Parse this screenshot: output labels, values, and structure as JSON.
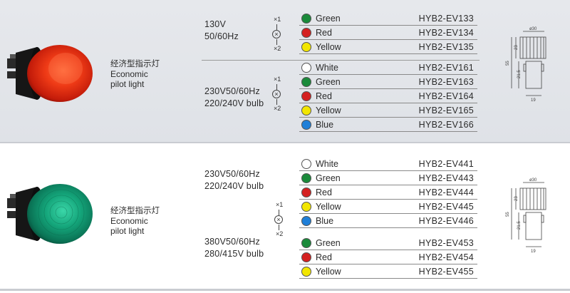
{
  "colors": {
    "green": "#1a8a3a",
    "red": "#d42020",
    "yellow": "#f2e600",
    "white": "#ffffff",
    "blue": "#1f7fd8"
  },
  "products": [
    {
      "name_cn": "经济型指示灯",
      "name_en_1": "Economic",
      "name_en_2": "pilot light",
      "symbol": {
        "x1": "×1",
        "x2": "×2"
      },
      "drawing": {
        "dim_top": "ø30",
        "dim_h1": "23",
        "dim_h2": "21.5",
        "dim_total": "55",
        "dim_bottom": "19"
      },
      "groups": [
        {
          "voltage_1": "130V",
          "voltage_2": "50/60Hz",
          "items": [
            {
              "color": "Green",
              "code": "HYB2-EV133",
              "dot": "green"
            },
            {
              "color": "Red",
              "code": "HYB2-EV134",
              "dot": "red"
            },
            {
              "color": "Yellow",
              "code": "HYB2-EV135",
              "dot": "yellow"
            }
          ]
        },
        {
          "voltage_1": "230V50/60Hz",
          "voltage_2": "220/240V bulb",
          "items": [
            {
              "color": "White",
              "code": "HYB2-EV161",
              "dot": "white"
            },
            {
              "color": "Green",
              "code": "HYB2-EV163",
              "dot": "green"
            },
            {
              "color": "Red",
              "code": "HYB2-EV164",
              "dot": "red"
            },
            {
              "color": "Yellow",
              "code": "HYB2-EV165",
              "dot": "yellow"
            },
            {
              "color": "Blue",
              "code": "HYB2-EV166",
              "dot": "blue"
            }
          ]
        }
      ]
    },
    {
      "name_cn": "经济型指示灯",
      "name_en_1": "Economic",
      "name_en_2": "pilot light",
      "symbol": {
        "x1": "×1",
        "x2": "×2"
      },
      "drawing": {
        "dim_top": "ø30",
        "dim_h1": "23",
        "dim_h2": "21.5",
        "dim_total": "55",
        "dim_bottom": "19"
      },
      "groups": [
        {
          "voltage_1": "230V50/60Hz",
          "voltage_2": "220/240V bulb",
          "items": [
            {
              "color": "White",
              "code": "HYB2-EV441",
              "dot": "white"
            },
            {
              "color": "Green",
              "code": "HYB2-EV443",
              "dot": "green"
            },
            {
              "color": "Red",
              "code": "HYB2-EV444",
              "dot": "red"
            },
            {
              "color": "Yellow",
              "code": "HYB2-EV445",
              "dot": "yellow"
            },
            {
              "color": "Blue",
              "code": "HYB2-EV446",
              "dot": "blue"
            }
          ]
        },
        {
          "voltage_1": "380V50/60Hz",
          "voltage_2": "280/415V bulb",
          "items": [
            {
              "color": "Green",
              "code": "HYB2-EV453",
              "dot": "green"
            },
            {
              "color": "Red",
              "code": "HYB2-EV454",
              "dot": "red"
            },
            {
              "color": "Yellow",
              "code": "HYB2-EV455",
              "dot": "yellow"
            }
          ]
        }
      ]
    }
  ]
}
